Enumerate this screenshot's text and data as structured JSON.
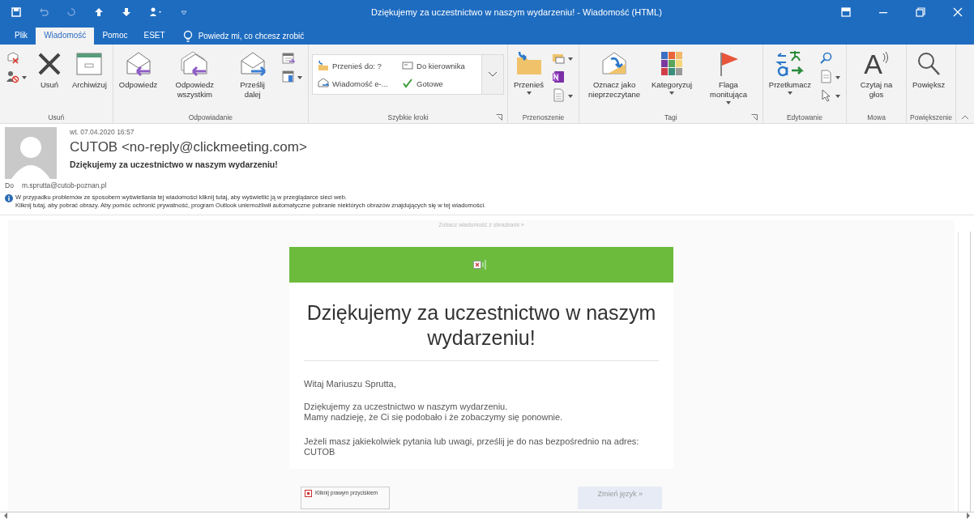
{
  "window": {
    "title": "Dziękujemy za uczestnictwo w naszym wydarzeniu!  -  Wiadomość (HTML)"
  },
  "tabs": [
    {
      "label": "Plik",
      "selected": false
    },
    {
      "label": "Wiadomość",
      "selected": true
    },
    {
      "label": "Pomoc",
      "selected": false
    },
    {
      "label": "ESET",
      "selected": false
    }
  ],
  "tell_me": {
    "placeholder": "Powiedz mi, co chcesz zrobić"
  },
  "ribbon": {
    "groups": [
      {
        "label": "Usuń",
        "launcher": false,
        "buttons": [
          {
            "kind": "smallstack",
            "items": [
              {
                "dropdown": false
              },
              {
                "dropdown": true
              }
            ]
          },
          {
            "kind": "large",
            "label": "Usuń",
            "dropdown": false
          },
          {
            "kind": "large",
            "label": "Archiwizuj",
            "dropdown": false
          }
        ]
      },
      {
        "label": "Odpowiadanie",
        "launcher": false,
        "buttons": [
          {
            "kind": "large",
            "label": "Odpowiedz",
            "dropdown": false
          },
          {
            "kind": "large",
            "label": "Odpowiedz wszystkim",
            "dropdown": false
          },
          {
            "kind": "large",
            "label": "Prześlij dalej",
            "dropdown": false
          },
          {
            "kind": "smallstack",
            "items": [
              {
                "dropdown": false
              },
              {
                "dropdown": true
              }
            ]
          }
        ]
      },
      {
        "label": "Szybkie kroki",
        "launcher": true,
        "buttons": [
          {
            "kind": "quick",
            "steps": [
              {
                "label": "Przenieś do: ?"
              },
              {
                "label": "Do kierownika"
              },
              {
                "label": "Wiadomość e-..."
              },
              {
                "label": "Gotowe"
              }
            ]
          }
        ]
      },
      {
        "label": "Przenoszenie",
        "launcher": false,
        "buttons": [
          {
            "kind": "large",
            "label": "Przenieś",
            "dropdown": true
          },
          {
            "kind": "smallstack",
            "items": [
              {
                "dropdown": true
              },
              {
                "dropdown": false
              },
              {
                "dropdown": true
              }
            ]
          }
        ]
      },
      {
        "label": "Tagi",
        "launcher": true,
        "buttons": [
          {
            "kind": "large",
            "label": "Oznacz jako nieprzeczytane",
            "dropdown": false
          },
          {
            "kind": "large",
            "label": "Kategoryzuj",
            "dropdown": true
          },
          {
            "kind": "large",
            "label": "Flaga monitująca",
            "dropdown": true
          }
        ]
      },
      {
        "label": "Edytowanie",
        "launcher": false,
        "buttons": [
          {
            "kind": "large",
            "label": "Przetłumacz",
            "dropdown": true
          },
          {
            "kind": "smallstack",
            "items": [
              {
                "dropdown": false
              },
              {
                "dropdown": true
              },
              {
                "dropdown": true
              }
            ]
          }
        ]
      },
      {
        "label": "Mowa",
        "launcher": false,
        "buttons": [
          {
            "kind": "glyph",
            "glyph": "A",
            "label": "Czytaj na głos",
            "dropdown": false
          }
        ]
      },
      {
        "label": "Powiększenie",
        "launcher": false,
        "buttons": [
          {
            "kind": "large",
            "label": "Powiększ",
            "dropdown": false
          }
        ]
      }
    ]
  },
  "message": {
    "date": "wt. 07.04.2020 16:57",
    "sender": "CUTOB <no-reply@clickmeeting.com>",
    "subject": "Dziękujemy za uczestnictwo w naszym wydarzeniu!",
    "to_label": "Do",
    "to": "m.sprutta@cutob-poznan.pl",
    "info": [
      "W przypadku problemów ze sposobem wyświetlania tej wiadomości kliknij tutaj, aby wyświetlić ją w przeglądarce sieci web.",
      "Kliknij tutaj, aby pobrać obrazy. Aby pomóc ochronić prywatność, program Outlook uniemożliwił automatyczne pobranie niektórych obrazów znajdujących się w tej wiadomości."
    ]
  },
  "email": {
    "view_link": "Zobacz wiadomość z obrazkami »",
    "heading": "Dziękujemy za uczestnictwo w naszym wydarzeniu!",
    "greeting": "Witaj Mariuszu Sprutta,",
    "paragraphs": [
      [
        "Dziękujemy za uczestnictwo w naszym wydarzeniu.",
        "Mamy nadzieję, że Ci się podobało i że zobaczymy się ponownie."
      ],
      [
        "Jeżeli masz jakiekolwiek pytania lub uwagi, prześlij je do nas bezpośrednio na adres:",
        "CUTOB"
      ]
    ],
    "image_alt": "Kliknij prawym przyciskiem",
    "language_button": "Zmień język »"
  }
}
